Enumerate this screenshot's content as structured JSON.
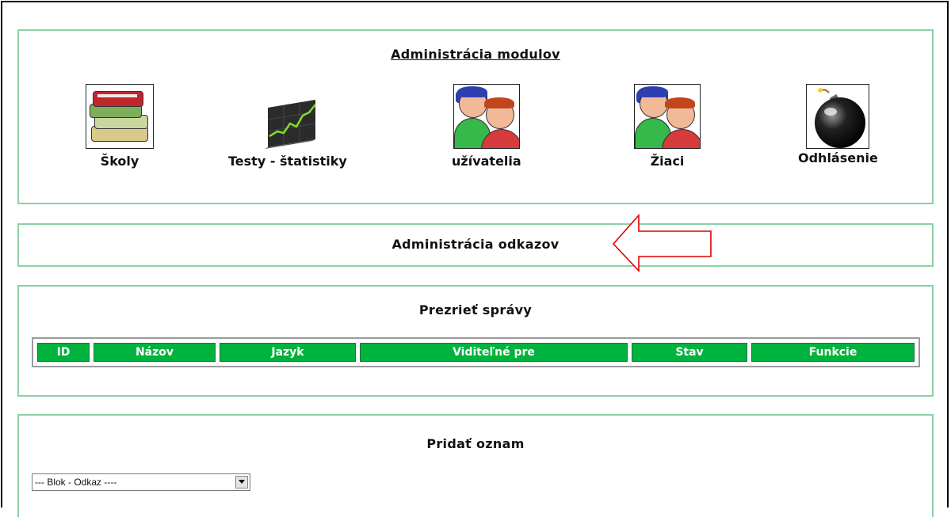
{
  "modules": {
    "title": "Administrácia modulov",
    "items": [
      {
        "label": "Školy",
        "icon": "books-icon"
      },
      {
        "label": "Testy - štatistiky",
        "icon": "chart-icon"
      },
      {
        "label": "užívatelia",
        "icon": "users-icon"
      },
      {
        "label": "Žiaci",
        "icon": "students-icon"
      },
      {
        "label": "Odhlásenie",
        "icon": "bomb-icon"
      }
    ]
  },
  "links": {
    "title": "Administrácia odkazov",
    "annotation_color": "#e00000"
  },
  "messages": {
    "title": "Prezrieť správy",
    "columns": [
      "ID",
      "Názov",
      "Jazyk",
      "Viditeľné pre",
      "Stav",
      "Funkcie"
    ],
    "header_color": "#00b33e"
  },
  "add": {
    "title": "Pridať oznam",
    "select_value": "--- Blok - Odkaz ----"
  },
  "colors": {
    "panel_border": "#8ed0a8"
  }
}
